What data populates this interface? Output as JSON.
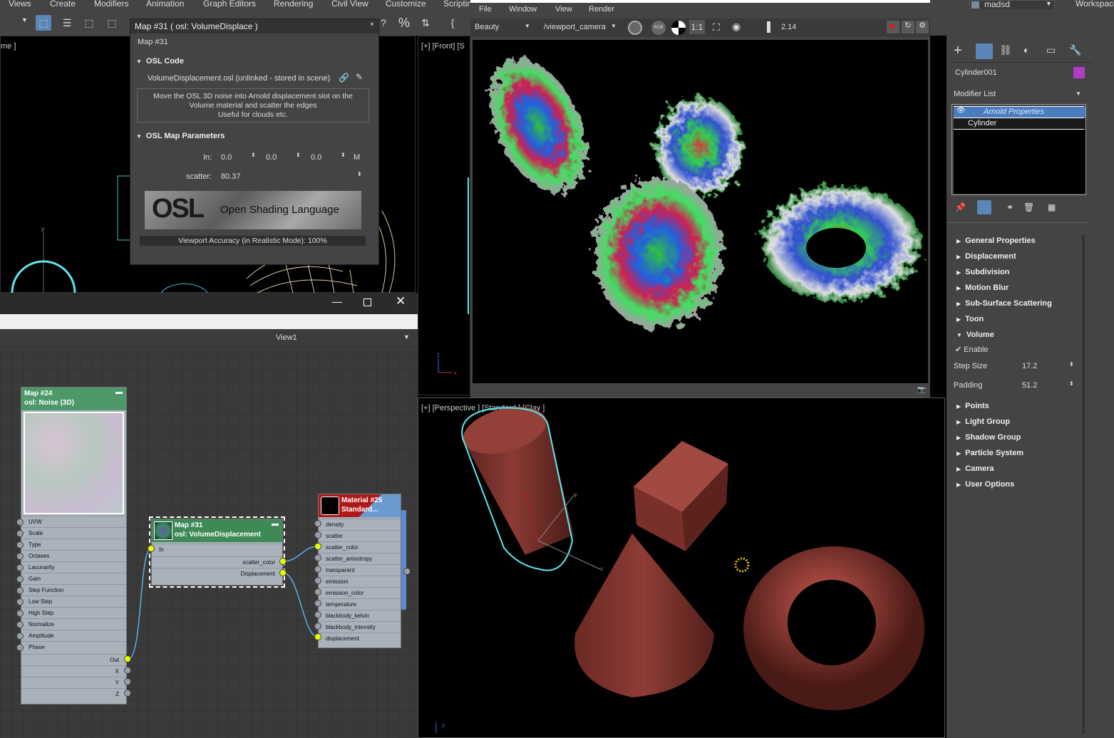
{
  "menubar": {
    "items": [
      "Views",
      "Create",
      "Modifiers",
      "Animation",
      "Graph Editors",
      "Rendering",
      "Civil View",
      "Customize",
      "Scriptin"
    ],
    "user": "madsd",
    "workspace": "Workspace"
  },
  "viewport_left_top": {
    "label": "me ]"
  },
  "viewport_front": {
    "label": "[+] [Front] [S"
  },
  "viewport_perspective": {
    "label": "[+] [Perspective ] [Standard ] [Clay ]"
  },
  "osl_dialog": {
    "title": "Map #31   ( osl: VolumeDisplace )",
    "map_name": "Map #31",
    "osl_code_header": "OSL Code",
    "file_text": "VolumeDisplacement.osl (unlinked - stored in scene)",
    "desc_line1": "Move the OSL 3D noise into Arnold displacement slot on the",
    "desc_line2": "Volume material and scatter the edges",
    "desc_line3": "Useful for clouds etc.",
    "params_header": "OSL Map Parameters",
    "in_label": "In:",
    "in_x": "0.0",
    "in_y": "0.0",
    "in_z": "0.0",
    "m_label": "M",
    "scatter_label": "scatter:",
    "scatter_value": "80.37",
    "logo_text": "Open Shading Language",
    "logo_mark": "OSL",
    "accuracy": "Viewport Accuracy (in Realistic Mode): 100%"
  },
  "slate": {
    "view_label": "View1",
    "node_noise": {
      "title1": "Map #24",
      "title2": "osl: Noise (3D)",
      "ports": [
        "UVW",
        "Scale",
        "Type",
        "Octaves",
        "Lacunarity",
        "Gain",
        "Step Function",
        "Low Step",
        "High Step",
        "Normalize",
        "Amplitude",
        "Phase"
      ],
      "outputs": [
        "Out",
        "X",
        "Y",
        "Z"
      ]
    },
    "node_vd": {
      "title1": "Map #31",
      "title2": "osl: VolumeDisplacement",
      "input": "In",
      "outputs": [
        "scatter_color",
        "Displacement"
      ]
    },
    "node_mat": {
      "title1": "Material #25",
      "title2": "Standard...",
      "ports": [
        "density",
        "scatter",
        "scatter_color",
        "scatter_anisotropy",
        "transparent",
        "emission",
        "emission_color",
        "temperature",
        "blackbody_kelvin",
        "blackbody_intensity",
        "displacement"
      ]
    }
  },
  "render_window": {
    "menu": [
      "File",
      "Window",
      "View",
      "Render"
    ],
    "aov": "Beauty",
    "camera": "/viewport_camera",
    "rgb": "RGB",
    "ratio": "1:1",
    "exposure": "2.14"
  },
  "command_panel": {
    "object_name": "Cylinder001",
    "object_color": "#b23cc8",
    "modifier_list": "Modifier List",
    "stack": [
      "Arnold Properties",
      "Cylinder"
    ],
    "rollouts_top": [
      "General Properties",
      "Displacement",
      "Subdivision",
      "Motion Blur",
      "Sub-Surface Scattering",
      "Toon"
    ],
    "volume_header": "Volume",
    "enable_label": "Enable",
    "step_size_label": "Step Size",
    "step_size_value": "17.2",
    "padding_label": "Padding",
    "padding_value": "51.2",
    "rollouts_bottom": [
      "Points",
      "Light Group",
      "Shadow Group",
      "Particle System",
      "Camera",
      "User Options"
    ]
  },
  "colors": {
    "accent": "#5aa0e6",
    "selection": "#5ee8f0",
    "clay": "#8a3a34",
    "node_green": "#3d8a57",
    "port_active": "#e6ff00"
  }
}
